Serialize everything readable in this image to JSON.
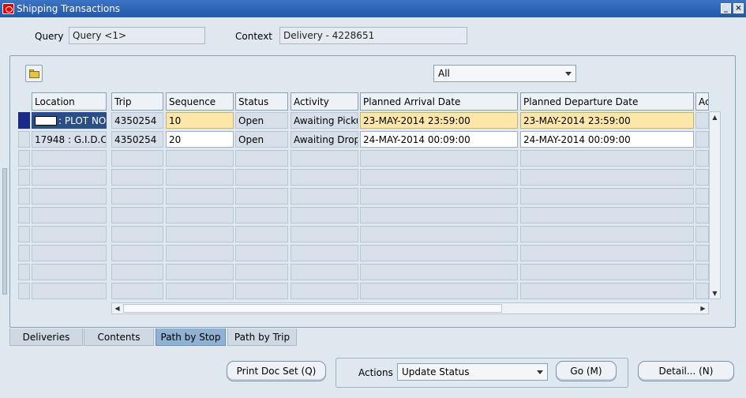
{
  "window": {
    "title": "Shipping Transactions"
  },
  "query": {
    "label": "Query",
    "value": "Query <1>"
  },
  "context": {
    "label": "Context",
    "value": "Delivery - 4228651"
  },
  "filter": {
    "selected": "All"
  },
  "grid": {
    "headers": [
      "Location",
      "Trip",
      "Sequence",
      "Status",
      "Activity",
      "Planned Arrival Date",
      "Planned Departure Date",
      "Ac"
    ],
    "rows": [
      {
        "location": ": PLOT NO",
        "trip": "4350254",
        "sequence": "10",
        "status": "Open",
        "activity": "Awaiting Picku",
        "arrival": "23-MAY-2014 23:59:00",
        "departure": "23-MAY-2014 23:59:00"
      },
      {
        "location": "17948 : G.I.D.C",
        "trip": "4350254",
        "sequence": "20",
        "status": "Open",
        "activity": "Awaiting Drop",
        "arrival": "24-MAY-2014 00:09:00",
        "departure": "24-MAY-2014 00:09:00"
      }
    ]
  },
  "tabs": [
    "Deliveries",
    "Contents",
    "Path by Stop",
    "Path by Trip"
  ],
  "buttons": {
    "print_doc_set": "Print Doc Set (Q)",
    "actions_label": "Actions",
    "actions_selected": "Update Status",
    "go": "Go (M)",
    "detail": "Detail... (N)"
  },
  "colors": {
    "titlebar": "#2b60b0",
    "selected_row": "#fce7a8",
    "active_tab": "#8fb1d4"
  }
}
